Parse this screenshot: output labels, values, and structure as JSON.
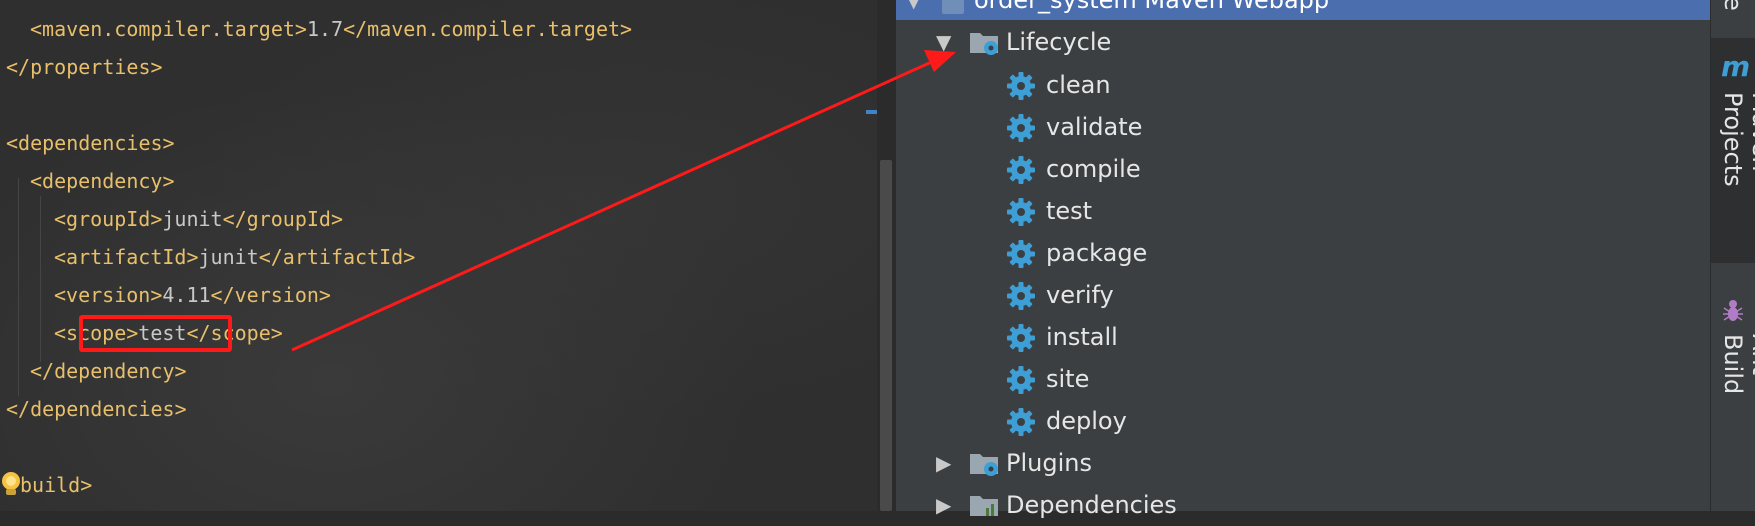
{
  "editor": {
    "lines": [
      {
        "tag": "<maven.compiler.target>",
        "text": "1.7",
        "close": "</maven.compiler.target>"
      },
      {
        "tag": "</properties>"
      },
      {
        "tag": "<dependencies>"
      },
      {
        "tag": "<dependency>"
      },
      {
        "tag": "<groupId>",
        "text": "junit",
        "close": "</groupId>"
      },
      {
        "tag": "<artifactId>",
        "text": "junit",
        "close": "</artifactId>"
      },
      {
        "tag": "<version>",
        "text": "4.11",
        "close": "</version>"
      },
      {
        "tag": "<scope>",
        "text": "test",
        "close": "</scope>"
      },
      {
        "tag": "</dependency>"
      },
      {
        "tag": "</dependencies>"
      },
      {
        "tag": "build>"
      }
    ]
  },
  "maven": {
    "project": "order_system Maven Webapp",
    "lifecycle_label": "Lifecycle",
    "goals": [
      "clean",
      "validate",
      "compile",
      "test",
      "package",
      "verify",
      "install",
      "site",
      "deploy"
    ],
    "plugins_label": "Plugins",
    "dependencies_label": "Dependencies"
  },
  "side_tabs": {
    "top_partial": "e",
    "maven_logo": "m",
    "maven_projects": "Maven Projects",
    "ant_build": "Ant Build"
  },
  "colors": {
    "accent": "#4b6eaf",
    "gear": "#3e9fd6",
    "highlight": "#ff1a1a",
    "xml_tag": "#e8bf6a"
  }
}
